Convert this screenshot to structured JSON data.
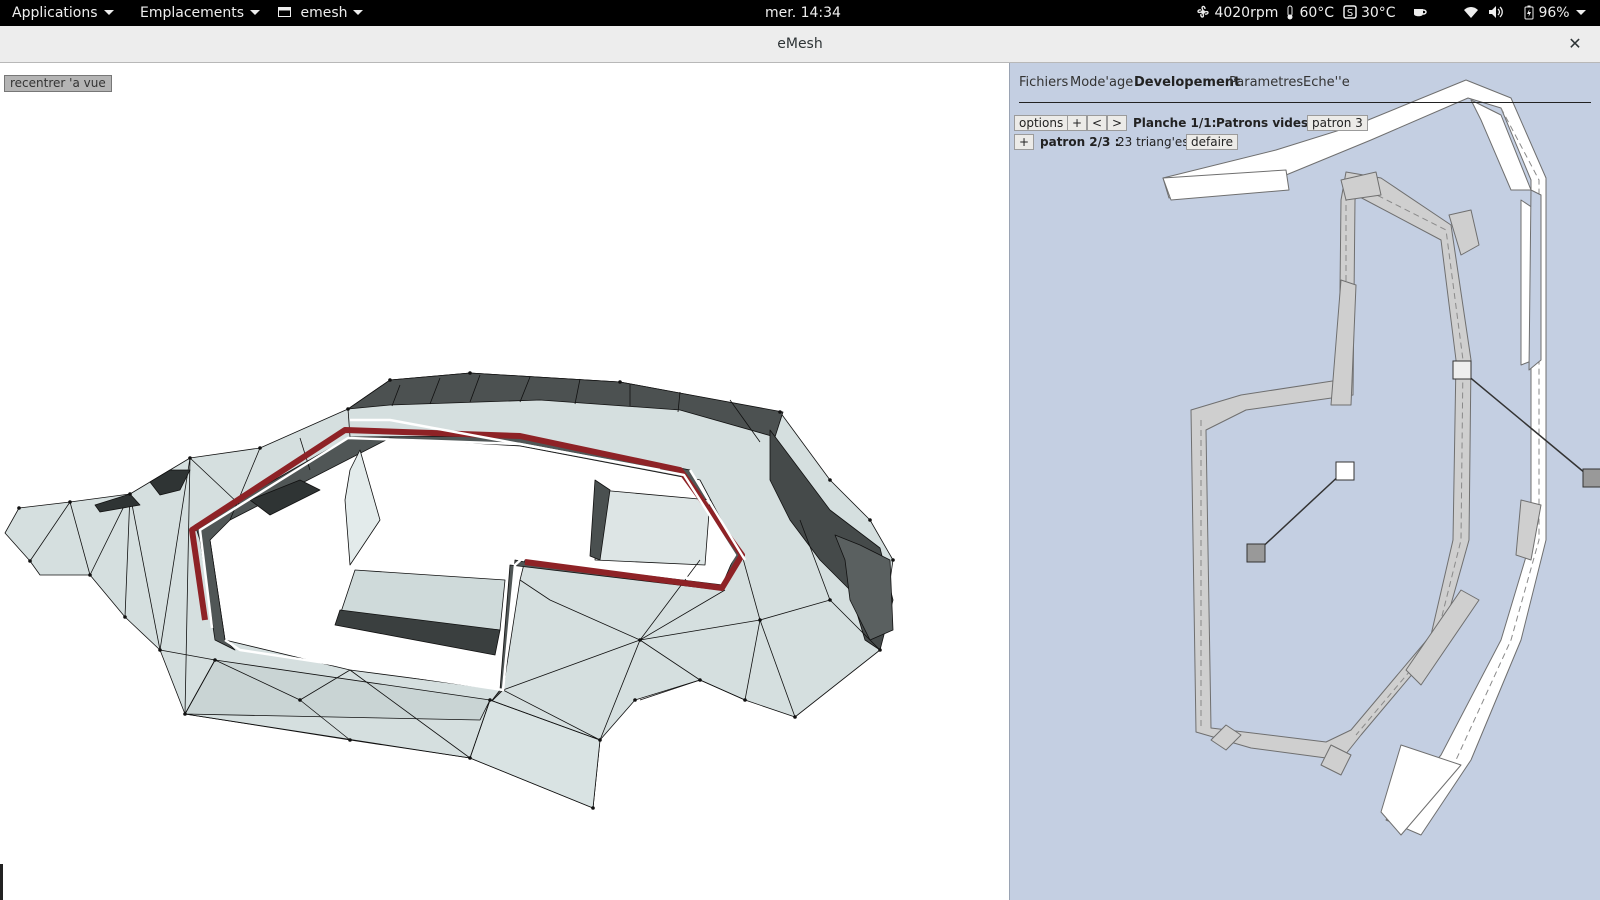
{
  "topbar": {
    "applications": "Applications",
    "places": "Emplacements",
    "app_menu": "emesh",
    "clock": "mer. 14:34",
    "fan": "4020rpm",
    "temp1": "60°C",
    "temp2": "30°C",
    "battery": "96%"
  },
  "window": {
    "title": "eMesh",
    "close": "✕"
  },
  "view3d": {
    "recenter_label": "recentrer 'a vue"
  },
  "menu": {
    "items": [
      "Fichiers",
      "Mode'age",
      "Developement",
      "Parametres",
      "Eche''e"
    ],
    "active": "Developement"
  },
  "toolbar": {
    "options": "options",
    "plus": "+",
    "prev": "<",
    "next": ">",
    "planche": "Planche 1/1:",
    "patrons_vides": "Patrons vides :",
    "patron_button": "patron 3",
    "row2_plus": "+",
    "patron_label": "patron 2/3 :",
    "triangles": "23 triang'es",
    "defaire": "defaire"
  },
  "colors": {
    "topbar_bg": "#000000",
    "panel_bg": "#c4cfe2",
    "mesh_light": "#d7e1e1",
    "mesh_dark": "#4b5050",
    "seam_red": "#8e2226",
    "pattern_grey": "#cfcfcf"
  }
}
